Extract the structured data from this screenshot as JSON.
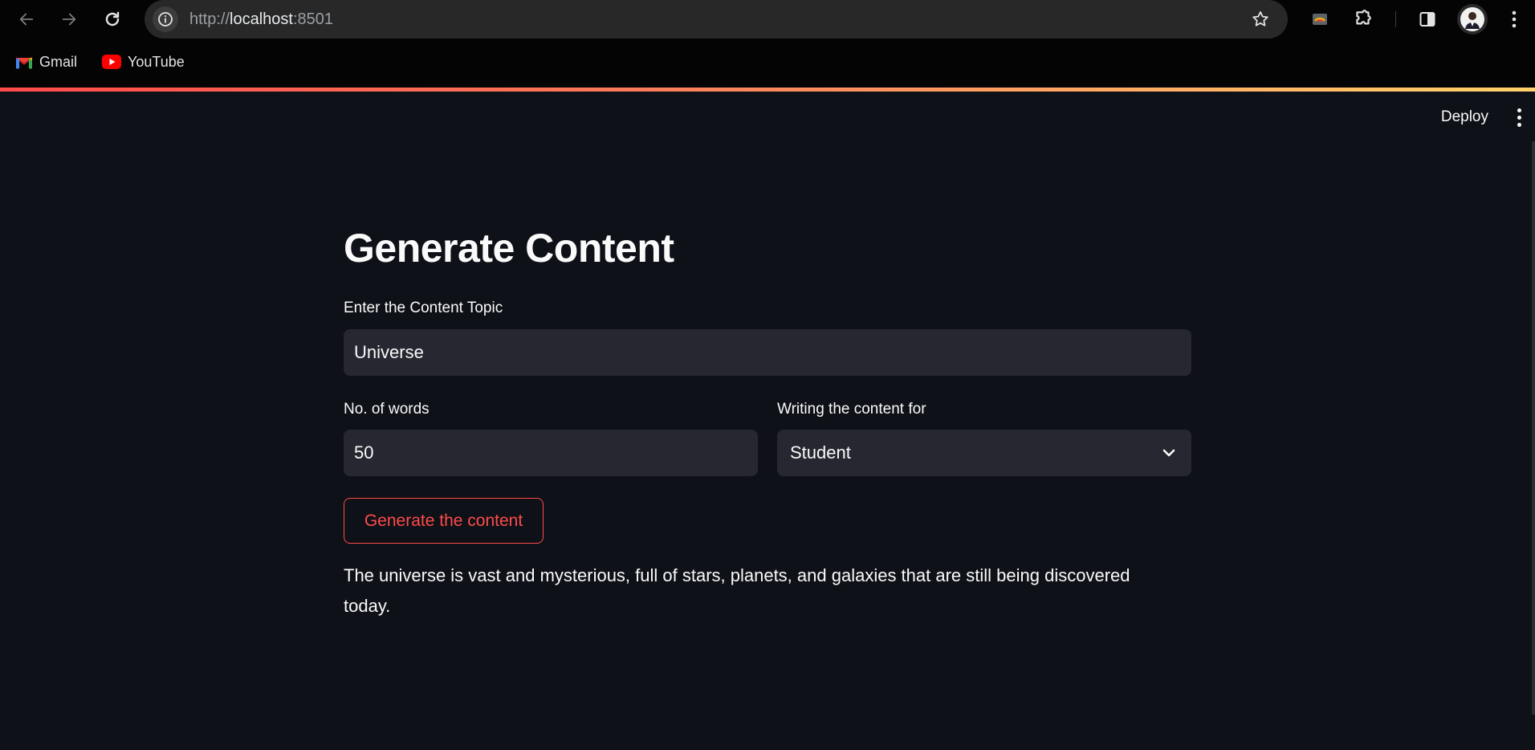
{
  "browser": {
    "url_scheme": "http://",
    "url_host": "localhost",
    "url_port": ":8501",
    "bookmarks": [
      {
        "label": "Gmail",
        "icon": "gmail-icon"
      },
      {
        "label": "YouTube",
        "icon": "youtube-icon"
      }
    ]
  },
  "app": {
    "header": {
      "deploy_label": "Deploy",
      "menu_icon": "kebab-menu-icon"
    },
    "title": "Generate Content",
    "topic": {
      "label": "Enter the Content Topic",
      "value": "Universe"
    },
    "words": {
      "label": "No. of words",
      "value": "50"
    },
    "audience": {
      "label": "Writing the content for",
      "selected": "Student"
    },
    "generate_label": "Generate the content",
    "output": "The universe is vast and mysterious, full of stars, planets, and galaxies that are still being discovered today."
  },
  "colors": {
    "accent": "#ff4b4b",
    "background": "#0e1117",
    "input_bg": "#262730",
    "text": "#fafafa"
  }
}
